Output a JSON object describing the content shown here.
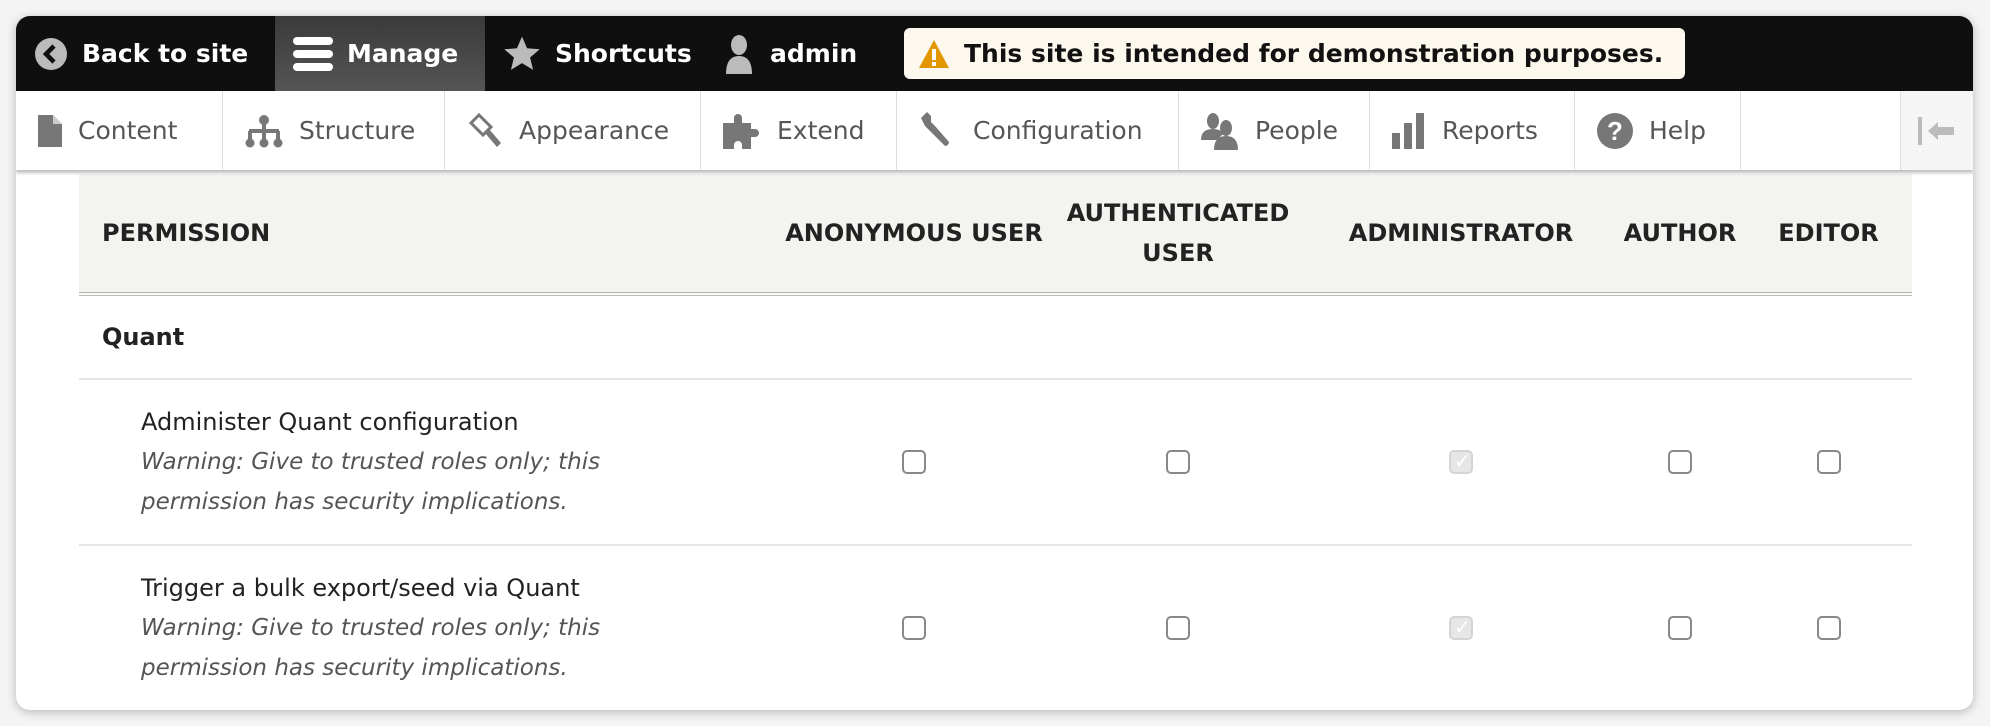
{
  "toolbar": {
    "back": "Back to site",
    "manage": "Manage",
    "shortcuts": "Shortcuts",
    "user": "admin",
    "warning": "This site is intended for demonstration purposes."
  },
  "tray": [
    {
      "label": "Content",
      "icon": "file-icon"
    },
    {
      "label": "Structure",
      "icon": "sitemap-icon"
    },
    {
      "label": "Appearance",
      "icon": "paintbrush-icon"
    },
    {
      "label": "Extend",
      "icon": "puzzle-icon"
    },
    {
      "label": "Configuration",
      "icon": "wrench-icon"
    },
    {
      "label": "People",
      "icon": "people-icon"
    },
    {
      "label": "Reports",
      "icon": "bar-chart-icon"
    },
    {
      "label": "Help",
      "icon": "help-icon"
    }
  ],
  "table": {
    "headers": [
      "PERMISSION",
      "ANONYMOUS USER",
      "AUTHENTICATED USER",
      "ADMINISTRATOR",
      "AUTHOR",
      "EDITOR"
    ],
    "group": "Quant",
    "rows": [
      {
        "name": "Administer Quant configuration",
        "desc": "Warning: Give to trusted roles only; this permission has security implications.",
        "checks": [
          false,
          false,
          true,
          false,
          false
        ],
        "disabled": [
          false,
          false,
          true,
          false,
          false
        ]
      },
      {
        "name": "Trigger a bulk export/seed via Quant",
        "desc": "Warning: Give to trusted roles only; this permission has security implications.",
        "checks": [
          false,
          false,
          true,
          false,
          false
        ],
        "disabled": [
          false,
          false,
          true,
          false,
          false
        ]
      }
    ]
  },
  "colors": {
    "toolbar_bg": "#0f0f0f",
    "warning_bg": "#fdf8ed",
    "warning_icon": "#e29700",
    "header_bg": "#f3f3f0"
  }
}
